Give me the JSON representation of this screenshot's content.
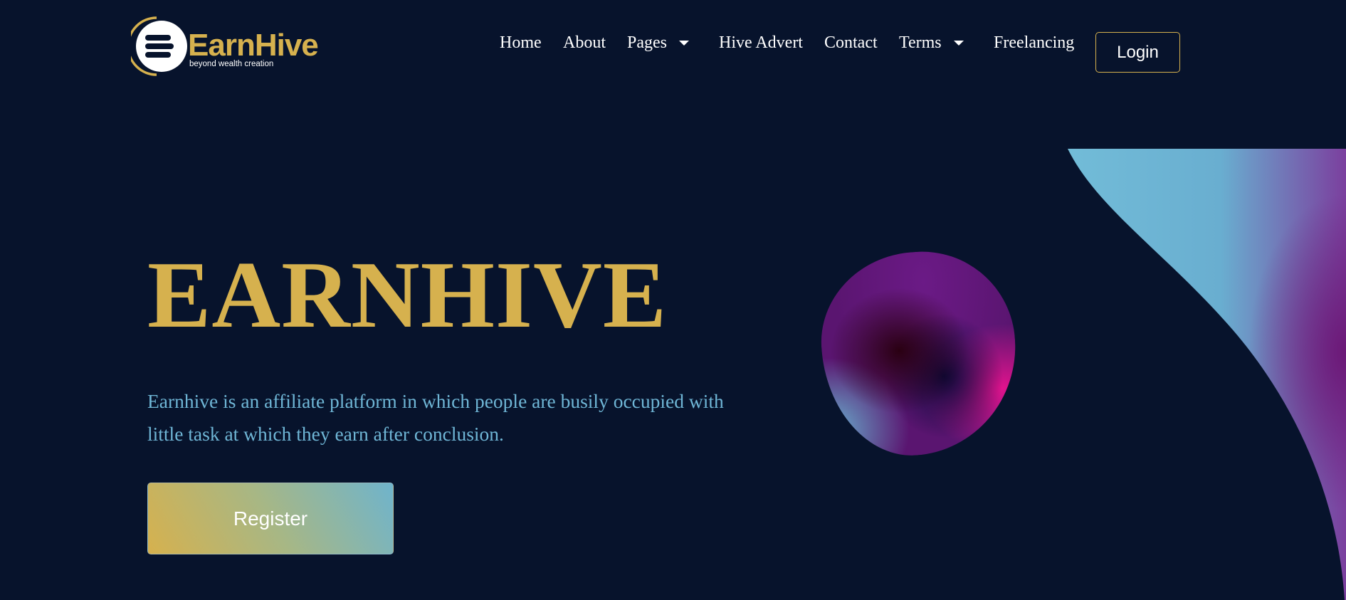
{
  "brand": {
    "name": "EarnHive",
    "tagline": "beyond wealth creation"
  },
  "nav": {
    "items": [
      {
        "label": "Home"
      },
      {
        "label": "About"
      },
      {
        "label": "Pages",
        "has_dropdown": true
      },
      {
        "label": "Hive Advert"
      },
      {
        "label": "Contact"
      },
      {
        "label": "Terms",
        "has_dropdown": true
      },
      {
        "label": "Freelancing"
      }
    ],
    "login_label": "Login",
    "dropdown_icon": "caret-down-icon"
  },
  "hero": {
    "title": "EARNHIVE",
    "description": "Earnhive is an affiliate platform in which people are busily occupied with little task at which they earn after conclusion.",
    "register_label": "Register"
  },
  "colors": {
    "background": "#07132c",
    "accent_gold": "#d6b14e",
    "text_blue": "#6fb6d6",
    "text_white": "#ffffff",
    "blob_pink": "#e0138d",
    "blob_purple": "#6b1a86",
    "wave_cyan": "#6fb6d6",
    "wave_purple": "#7b3f9e"
  }
}
